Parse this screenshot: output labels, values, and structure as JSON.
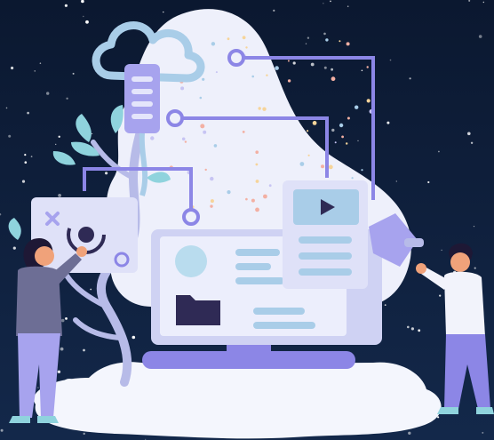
{
  "scene": {
    "kind": "illustration",
    "colors": {
      "sky_top": "#0b1830",
      "sky_bottom": "#13284a",
      "blob": "#eef0fb",
      "screen_frame": "#cfd2f3",
      "screen_face": "#e4e5fb",
      "accent": "#8c86e6",
      "accent_dark": "#6c66cf",
      "cloud": "#a9cde8",
      "folder": "#2f2a55",
      "leaf": "#8fd3dd",
      "skin": "#f0a27a",
      "hair": "#1e1835"
    },
    "icons": [
      "cloud-icon",
      "play-icon",
      "folder-icon",
      "close-icon",
      "touch-icon",
      "circle-icon"
    ],
    "people": [
      "woman-touching-panel",
      "man-plugging-cable"
    ]
  }
}
